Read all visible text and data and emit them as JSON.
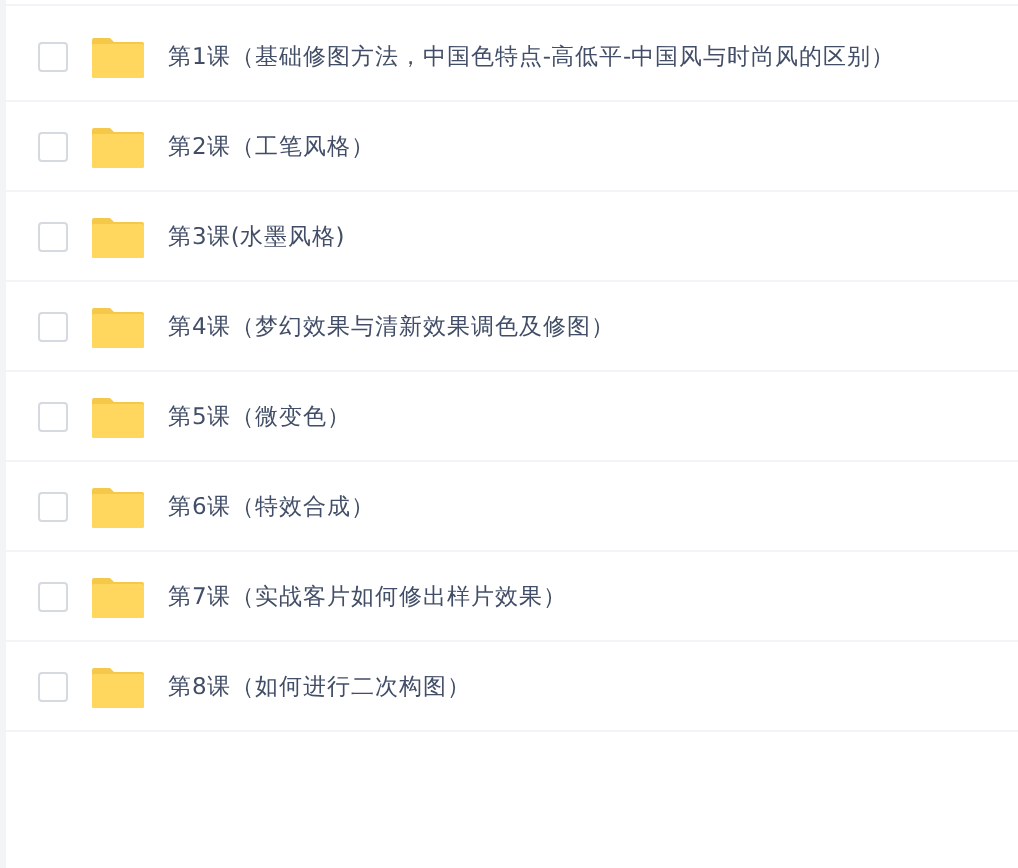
{
  "files": [
    {
      "name": "第1课（基础修图方法，中国色特点-高低平-中国风与时尚风的区别）",
      "checked": false
    },
    {
      "name": "第2课（工笔风格）",
      "checked": false
    },
    {
      "name": "第3课(水墨风格)",
      "checked": false
    },
    {
      "name": "第4课（梦幻效果与清新效果调色及修图）",
      "checked": false
    },
    {
      "name": "第5课（微变色）",
      "checked": false
    },
    {
      "name": "第6课（特效合成）",
      "checked": false
    },
    {
      "name": "第7课（实战客片如何修出样片效果）",
      "checked": false
    },
    {
      "name": "第8课（如何进行二次构图）",
      "checked": false
    }
  ]
}
